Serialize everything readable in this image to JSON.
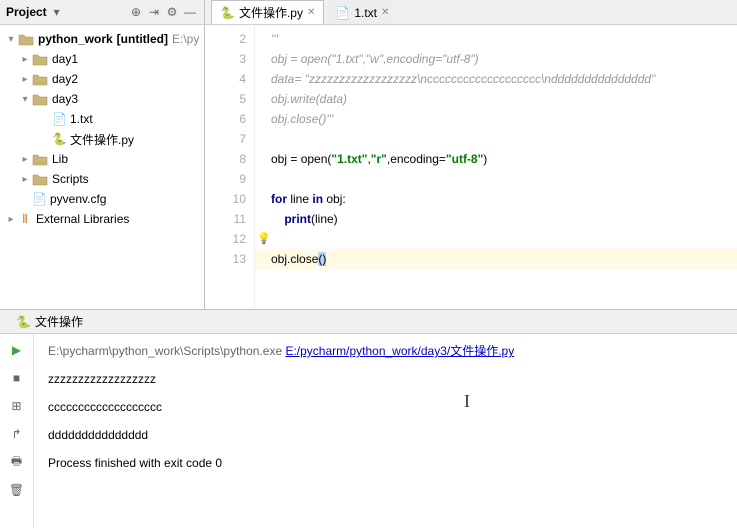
{
  "toolbar": {
    "project_label": "Project"
  },
  "tree": {
    "root_name": "python_work",
    "root_suffix": "[untitled]",
    "root_path": "E:\\py",
    "day1": "day1",
    "day2": "day2",
    "day3": "day3",
    "file_txt": "1.txt",
    "file_py": "文件操作.py",
    "lib": "Lib",
    "scripts": "Scripts",
    "pyvenv": "pyvenv.cfg",
    "extlib": "External Libraries"
  },
  "tabs": {
    "tab1": "文件操作.py",
    "tab2": "1.txt"
  },
  "gutter": [
    "2",
    "3",
    "4",
    "5",
    "6",
    "7",
    "8",
    "9",
    "10",
    "11",
    "12",
    "13"
  ],
  "code": {
    "l2": "'''",
    "l3a": "obj = open(\"1.txt\",\"w\",encoding=\"utf-8\")",
    "l4": "data= \"zzzzzzzzzzzzzzzzzz\\nccccccccccccccccccc\\nddddddddddddddd\"",
    "l5": "obj.write(data)",
    "l6": "obj.close()'''",
    "l8_pre": "obj = open(",
    "l8_s1": "\"1.txt\"",
    "l8_c": ",",
    "l8_s2": "\"r\"",
    "l8_c2": ",encoding=",
    "l8_s3": "\"utf-8\"",
    "l8_post": ")",
    "l10_for": "for",
    "l10_mid": " line ",
    "l10_in": "in",
    "l10_end": " obj:",
    "l11_print": "    print",
    "l11_end": "(line)",
    "l13_pre": "obj.close",
    "l13_sel": "()"
  },
  "console": {
    "title": "文件操作",
    "exe": "E:\\pycharm\\python_work\\Scripts\\python.exe ",
    "script": "E:/pycharm/python_work/day3/文件操作.py",
    "out1": "zzzzzzzzzzzzzzzzzz",
    "out2": "ccccccccccccccccccc",
    "out3": "ddddddddddddddd",
    "exit": "Process finished with exit code 0"
  }
}
